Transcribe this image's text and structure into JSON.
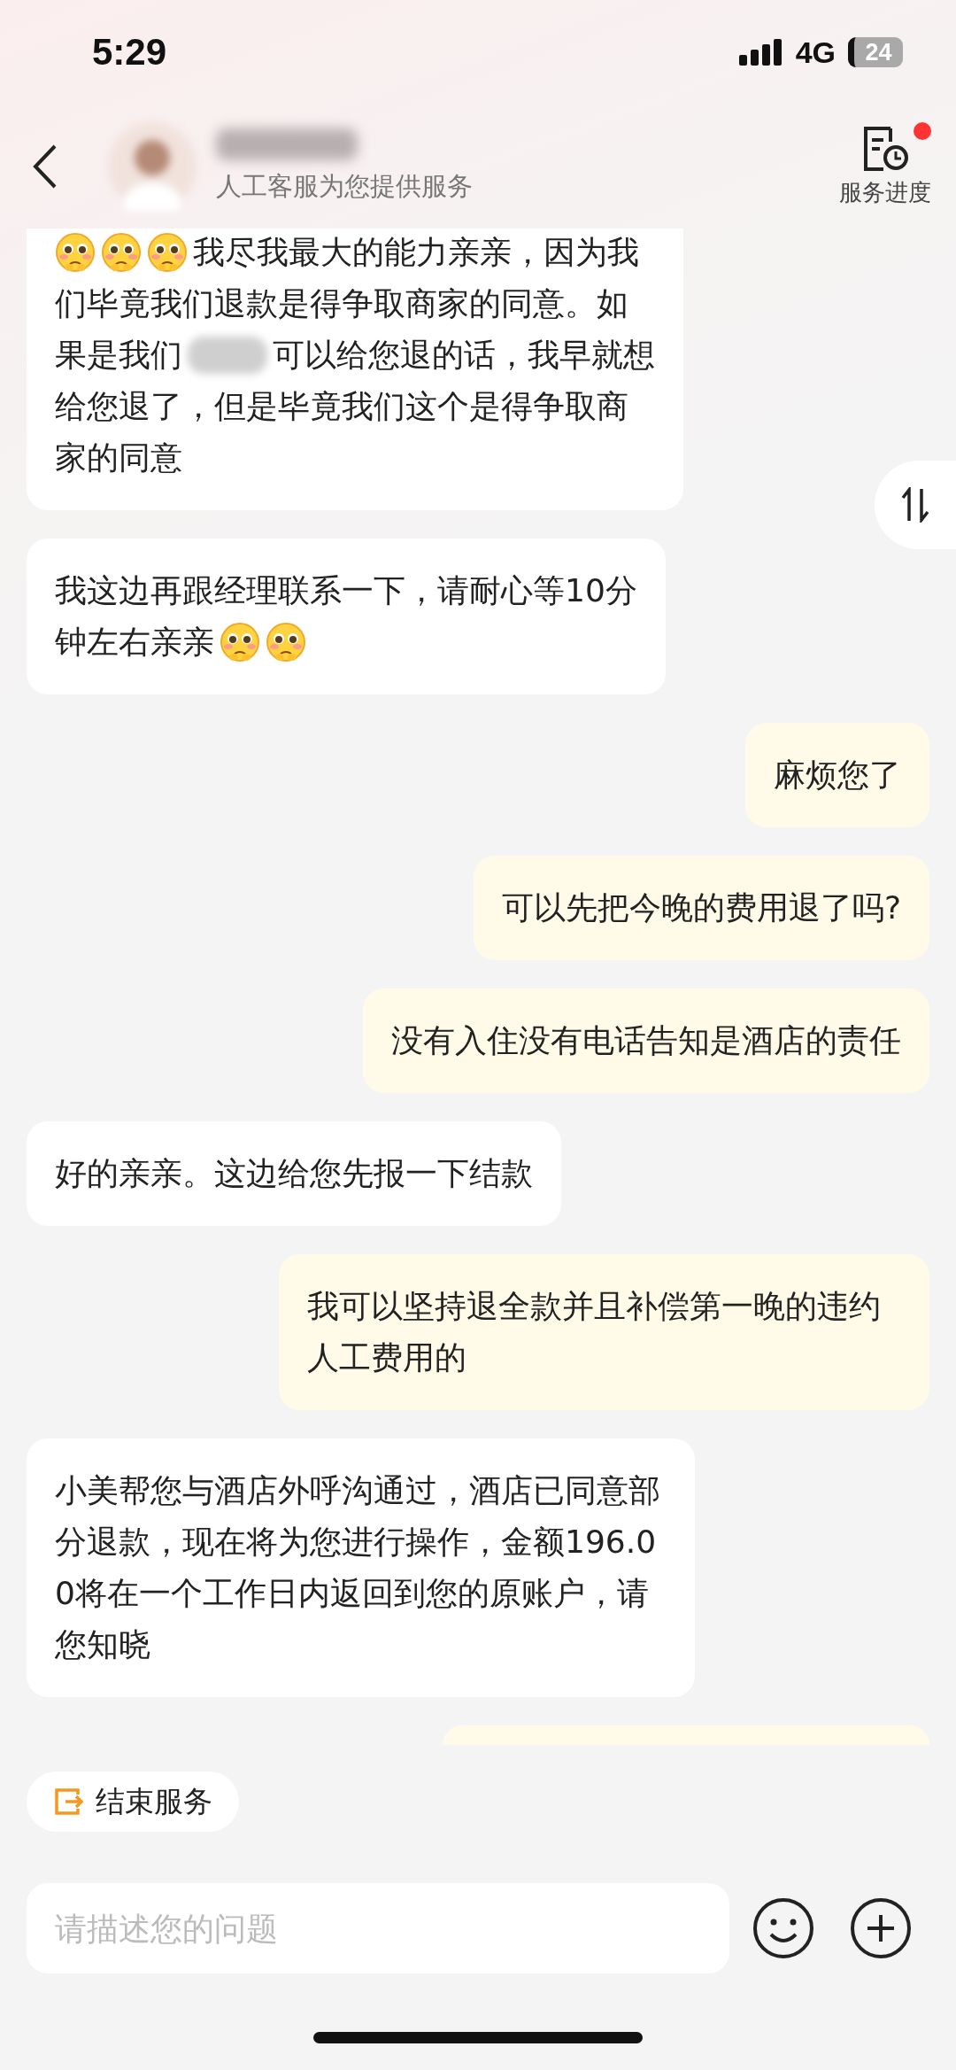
{
  "status_bar": {
    "time": "5:29",
    "network": "4G",
    "battery": "24"
  },
  "header": {
    "subtitle": "人工客服为您提供服务",
    "progress_label": "服务进度",
    "progress_unread": true
  },
  "messages": [
    {
      "kind": "received",
      "lines": [
        [
          {
            "kind": "emoji"
          },
          {
            "kind": "emoji"
          },
          {
            "kind": "emoji"
          },
          {
            "kind": "text",
            "text": "我尽我最大的能力亲亲，因为我"
          }
        ],
        [
          {
            "kind": "text",
            "text": "们毕竟我们退款是得争取商家的同意。如"
          }
        ],
        [
          {
            "kind": "text",
            "text": "果是我们"
          },
          {
            "kind": "redacted"
          },
          {
            "kind": "text",
            "text": "可以给您退的话，我早就想"
          }
        ],
        [
          {
            "kind": "text",
            "text": "给您退了，但是毕竟我们这个是得争取商"
          }
        ],
        [
          {
            "kind": "text",
            "text": "家的同意"
          }
        ]
      ]
    },
    {
      "kind": "received",
      "lines": [
        [
          {
            "kind": "text",
            "text": "我这边再跟经理联系一下，请耐心等10分"
          }
        ],
        [
          {
            "kind": "text",
            "text": "钟左右亲亲"
          },
          {
            "kind": "emoji"
          },
          {
            "kind": "emoji"
          }
        ]
      ]
    },
    {
      "kind": "sent",
      "lines": [
        [
          {
            "kind": "text",
            "text": "麻烦您了"
          }
        ]
      ]
    },
    {
      "kind": "sent",
      "lines": [
        [
          {
            "kind": "text",
            "text": "可以先把今晚的费用退了吗?"
          }
        ]
      ]
    },
    {
      "kind": "sent",
      "lines": [
        [
          {
            "kind": "text",
            "text": "没有入住没有电话告知是酒店的责任"
          }
        ]
      ]
    },
    {
      "kind": "received",
      "lines": [
        [
          {
            "kind": "text",
            "text": "好的亲亲。这边给您先报一下结款"
          }
        ]
      ]
    },
    {
      "kind": "sent",
      "lines": [
        [
          {
            "kind": "text",
            "text": "我可以坚持退全款并且补偿第一晚的违约人工费用的"
          }
        ]
      ]
    },
    {
      "kind": "received",
      "lines": [
        [
          {
            "kind": "text",
            "text": "小美帮您与酒店外呼沟通过，酒店已同意部分退款，现在将为您进行操作，金额196.00将在一个工作日内返回到您的原账户，请您知晓"
          }
        ]
      ]
    }
  ],
  "end_service": {
    "label": "结束服务"
  },
  "input": {
    "placeholder": "请描述您的问题"
  }
}
